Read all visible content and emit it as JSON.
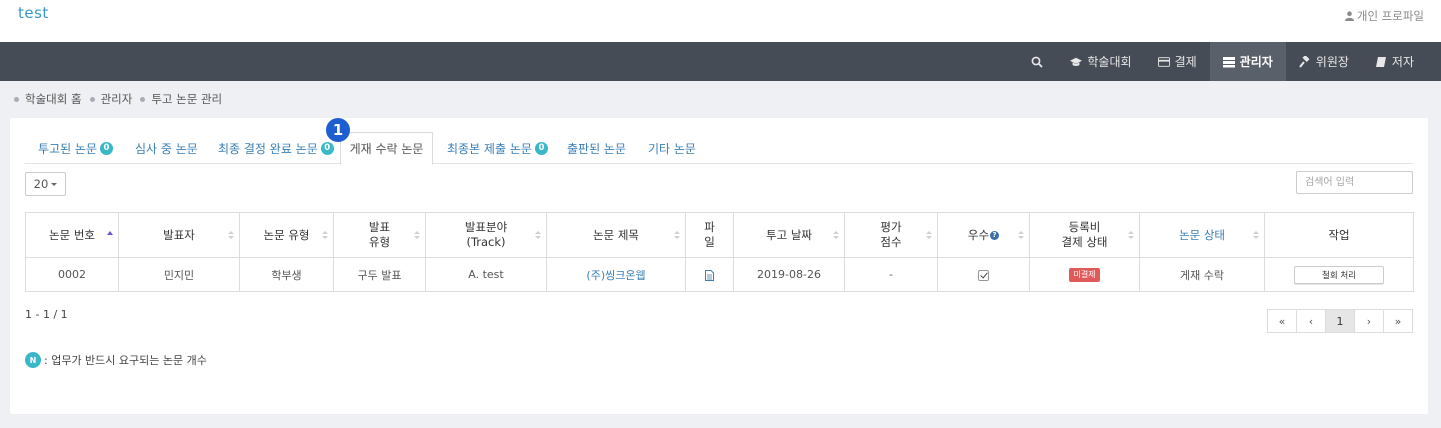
{
  "header": {
    "site_title": "test",
    "profile_label": "개인 프로파일"
  },
  "nav": {
    "items": [
      {
        "label": "학술대회",
        "icon": "graduation-cap-icon"
      },
      {
        "label": "결제",
        "icon": "credit-card-icon"
      },
      {
        "label": "관리자",
        "icon": "server-icon"
      },
      {
        "label": "위원장",
        "icon": "gavel-icon"
      },
      {
        "label": "저자",
        "icon": "book-icon"
      }
    ],
    "active_index": 2
  },
  "breadcrumb": [
    "학술대회 홈",
    "관리자",
    "투고 논문 관리"
  ],
  "tabs": [
    {
      "label": "투고된 논문",
      "badge": "0"
    },
    {
      "label": "심사 중 논문",
      "badge": ""
    },
    {
      "label": "최종 결정 완료 논문",
      "badge": "0"
    },
    {
      "label": "게재 수락 논문",
      "badge": "",
      "active": true
    },
    {
      "label": "최종본 제출 논문",
      "badge": "0"
    },
    {
      "label": "출판된 논문",
      "badge": ""
    },
    {
      "label": "기타 논문",
      "badge": ""
    }
  ],
  "step_marker": "1",
  "toolbar": {
    "page_size": "20",
    "search_placeholder": "검색어 입력"
  },
  "table": {
    "columns": [
      "논문 번호",
      "발표자",
      "논문 유형",
      "발표\n유형",
      "발표분야\n(Track)",
      "논문 제목",
      "파\n일",
      "투고 날짜",
      "평가\n점수",
      "우수",
      "등록비\n결제 상태",
      "논문 상태",
      "작업"
    ],
    "rows": [
      {
        "paper_no": "0002",
        "presenter": "민지민",
        "paper_type": "학부생",
        "presentation_type": "구두 발표",
        "track": "A. test",
        "title": "(주)씽크온웹",
        "submitted": "2019-08-26",
        "score": "-",
        "excellent": true,
        "payment_status": "미결제",
        "paper_status": "게재 수락",
        "action_label": "철회 처리"
      }
    ]
  },
  "range_text": "1 - 1 / 1",
  "pagination": [
    "«",
    "‹",
    "1",
    "›",
    "»"
  ],
  "pagination_active": 2,
  "legend": {
    "badge": "N",
    "text": ": 업무가 반드시 요구되는 논문 개수"
  },
  "colors": {
    "accent": "#3a97c9",
    "nav_bg": "#464c55",
    "badge": "#3ab8c8",
    "unpaid": "#e05a5a",
    "step": "#1d5fd0"
  }
}
